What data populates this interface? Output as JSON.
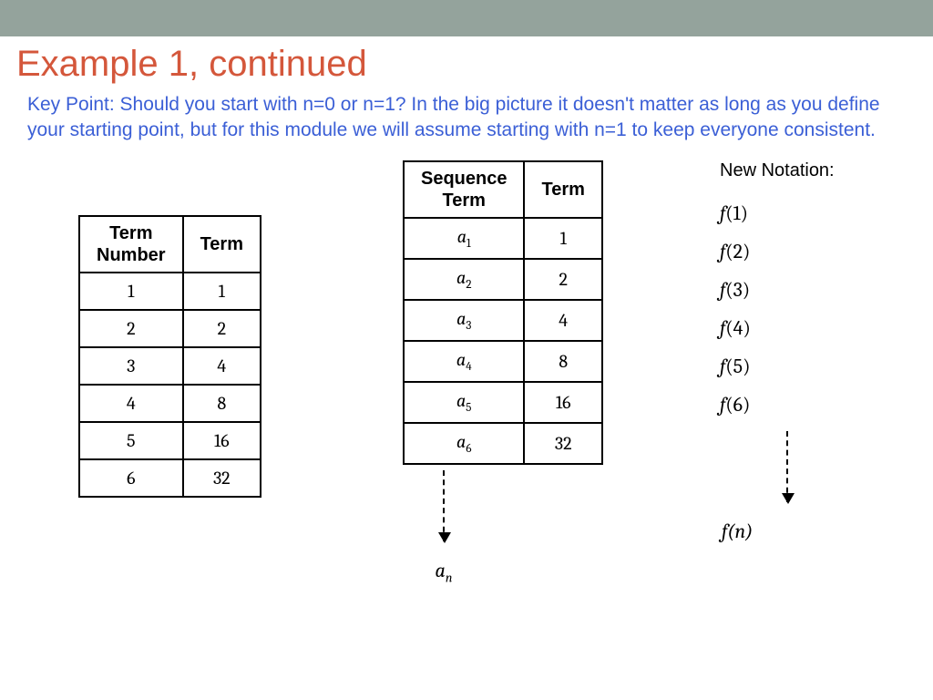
{
  "title": "Example 1, continued",
  "keypoint": "Key Point: Should you start with n=0 or n=1? In the big picture it doesn't matter as long as you define your starting point, but for this module we will assume starting with n=1 to keep everyone consistent.",
  "table1": {
    "head_col1_line1": "Term",
    "head_col1_line2": "Number",
    "head_col2": "Term",
    "rows": [
      {
        "n": "1",
        "t": "1"
      },
      {
        "n": "2",
        "t": "2"
      },
      {
        "n": "3",
        "t": "4"
      },
      {
        "n": "4",
        "t": "8"
      },
      {
        "n": "5",
        "t": "16"
      },
      {
        "n": "6",
        "t": "32"
      }
    ]
  },
  "table2": {
    "head_col1_line1": "Sequence",
    "head_col1_line2": "Term",
    "head_col2": "Term",
    "rows": [
      {
        "sub": "1",
        "t": "1"
      },
      {
        "sub": "2",
        "t": "2"
      },
      {
        "sub": "3",
        "t": "4"
      },
      {
        "sub": "4",
        "t": "8"
      },
      {
        "sub": "5",
        "t": "16"
      },
      {
        "sub": "6",
        "t": "32"
      }
    ],
    "general_sub": "n",
    "var": "a"
  },
  "notation": {
    "title": "New Notation:",
    "fn": "f",
    "items": [
      "1",
      "2",
      "3",
      "4",
      "5",
      "6"
    ],
    "general": "n"
  }
}
